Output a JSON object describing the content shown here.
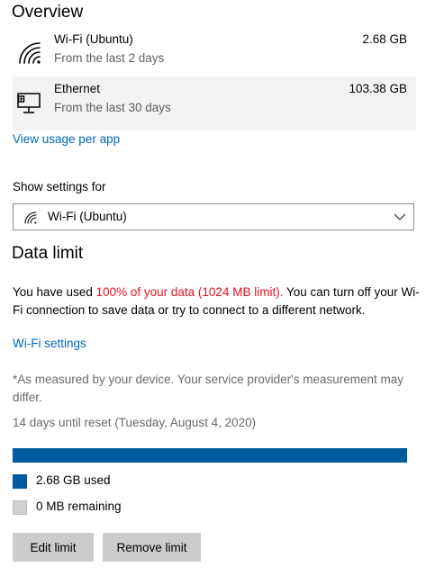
{
  "overview": {
    "title": "Overview",
    "networks": [
      {
        "name": "Wi-Fi (Ubuntu)",
        "period": "From the last 2 days",
        "usage": "2.68 GB",
        "icon": "wifi-icon",
        "selected": false
      },
      {
        "name": "Ethernet",
        "period": "From the last 30 days",
        "usage": "103.38 GB",
        "icon": "ethernet-icon",
        "selected": true
      }
    ],
    "view_usage_link": "View usage per app"
  },
  "show_settings": {
    "label": "Show settings for",
    "selected": "Wi-Fi (Ubuntu)",
    "icon": "wifi-icon"
  },
  "data_limit": {
    "title": "Data limit",
    "message_prefix": "You have used ",
    "message_highlight": "100% of your data (1024 MB limit).",
    "message_suffix": "  You can turn off your Wi-Fi connection to save data or try to connect to a different network.",
    "wifi_settings_link": "Wi-Fi settings",
    "measurement_note": "*As measured by your device. Your service provider's measurement may differ.",
    "reset_text": "14 days until reset (Tuesday, August 4, 2020)",
    "usage_fraction": 1.0,
    "used_label": "2.68 GB used",
    "remaining_label": "0 MB remaining",
    "edit_button": "Edit limit",
    "remove_button": "Remove limit"
  },
  "colors": {
    "accent_link": "#0067c0",
    "warning_text": "#e81123",
    "used_bar": "#005a9e",
    "remaining_bar": "#d0d0d0",
    "button_bg": "#cccccc",
    "selected_row": "#f2f2f2"
  }
}
